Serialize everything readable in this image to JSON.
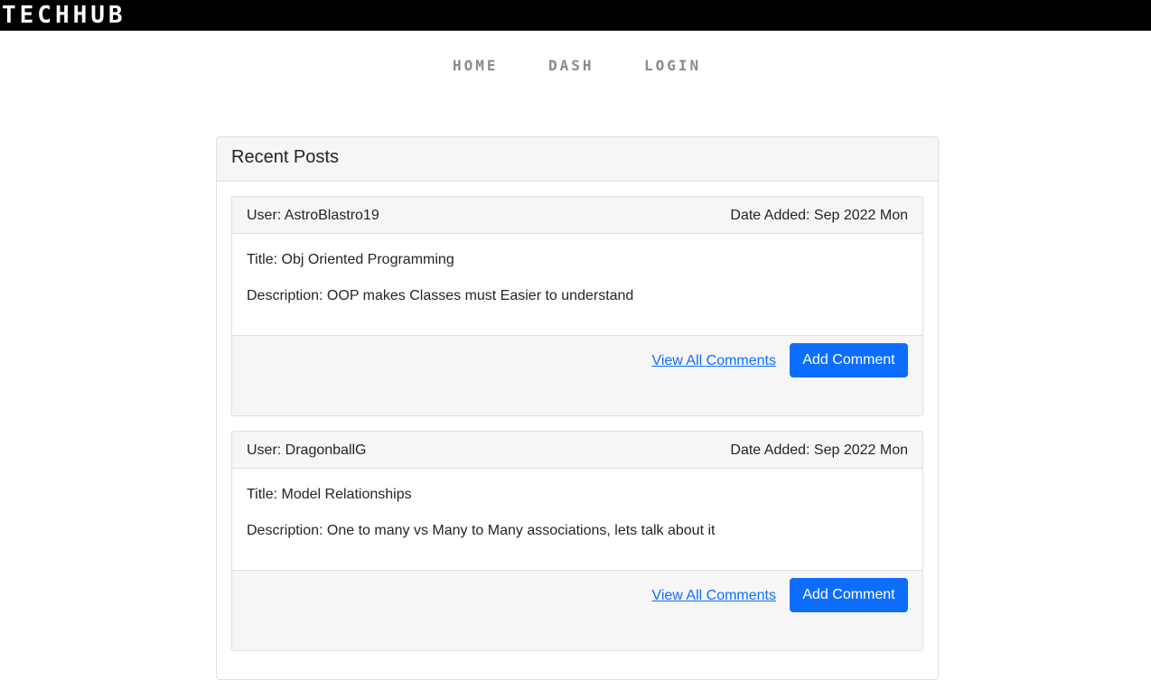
{
  "brand": "TECHHUB",
  "nav": {
    "home": "HOME",
    "dash": "DASH",
    "login": "LOGIN"
  },
  "recent": {
    "title": "Recent Posts"
  },
  "posts": [
    {
      "user": "User: AstroBlastro19",
      "date": "Date Added: Sep 2022 Mon",
      "title": "Title: Obj Oriented Programming",
      "description": "Description: OOP makes Classes must Easier to understand",
      "view_label": "View All Comments",
      "add_label": "Add Comment"
    },
    {
      "user": "User: DragonballG",
      "date": "Date Added: Sep 2022 Mon",
      "title": "Title: Model Relationships",
      "description": "Description: One to many vs Many to Many associations, lets talk about it",
      "view_label": "View All Comments",
      "add_label": "Add Comment"
    }
  ],
  "colors": {
    "topbar": "#000000",
    "accent": "#0d6efd",
    "nav_text": "#8a8a8a",
    "card_header_bg": "#f6f6f6",
    "border": "#dedede"
  }
}
